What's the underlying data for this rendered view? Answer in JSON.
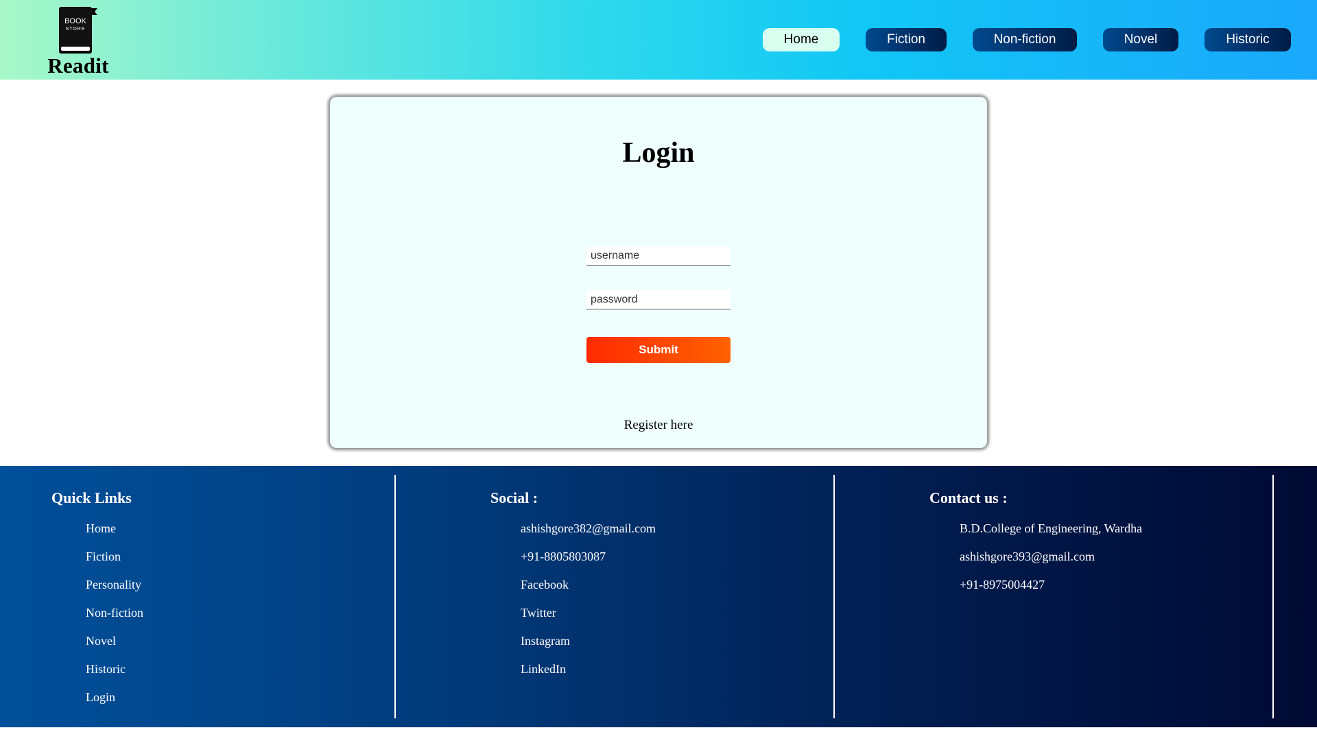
{
  "header": {
    "logo": {
      "icon_text_top": "BOOK",
      "icon_text_bottom": "STORE",
      "name": "Readit"
    },
    "nav": [
      {
        "label": "Home",
        "active": true
      },
      {
        "label": "Fiction",
        "active": false
      },
      {
        "label": "Non-fiction",
        "active": false
      },
      {
        "label": "Novel",
        "active": false
      },
      {
        "label": "Historic",
        "active": false
      }
    ]
  },
  "login": {
    "title": "Login",
    "username_placeholder": "username",
    "password_placeholder": "password",
    "submit_label": "Submit",
    "register_label": "Register here"
  },
  "footer": {
    "quick_links": {
      "heading": "Quick Links",
      "items": [
        "Home",
        "Fiction",
        "Personality",
        "Non-fiction",
        "Novel",
        "Historic",
        "Login"
      ]
    },
    "social": {
      "heading": "Social :",
      "items": [
        "ashishgore382@gmail.com",
        "+91-8805803087",
        "Facebook",
        "Twitter",
        "Instagram",
        "LinkedIn"
      ]
    },
    "contact": {
      "heading": "Contact us :",
      "items": [
        "B.D.College of Engineering, Wardha",
        "ashishgore393@gmail.com",
        "+91-8975004427"
      ]
    }
  },
  "colors": {
    "header_gradient_start": "#a8f8c8",
    "header_gradient_end": "#1aa8fb",
    "nav_button": "#012d63",
    "nav_active": "#d9fff0",
    "card_background": "#effffe",
    "submit_start": "#ff2a00",
    "submit_end": "#ff6200",
    "footer_start": "#01509a",
    "footer_end": "#000a33"
  },
  "icons": {
    "logo": "book-store-icon"
  }
}
